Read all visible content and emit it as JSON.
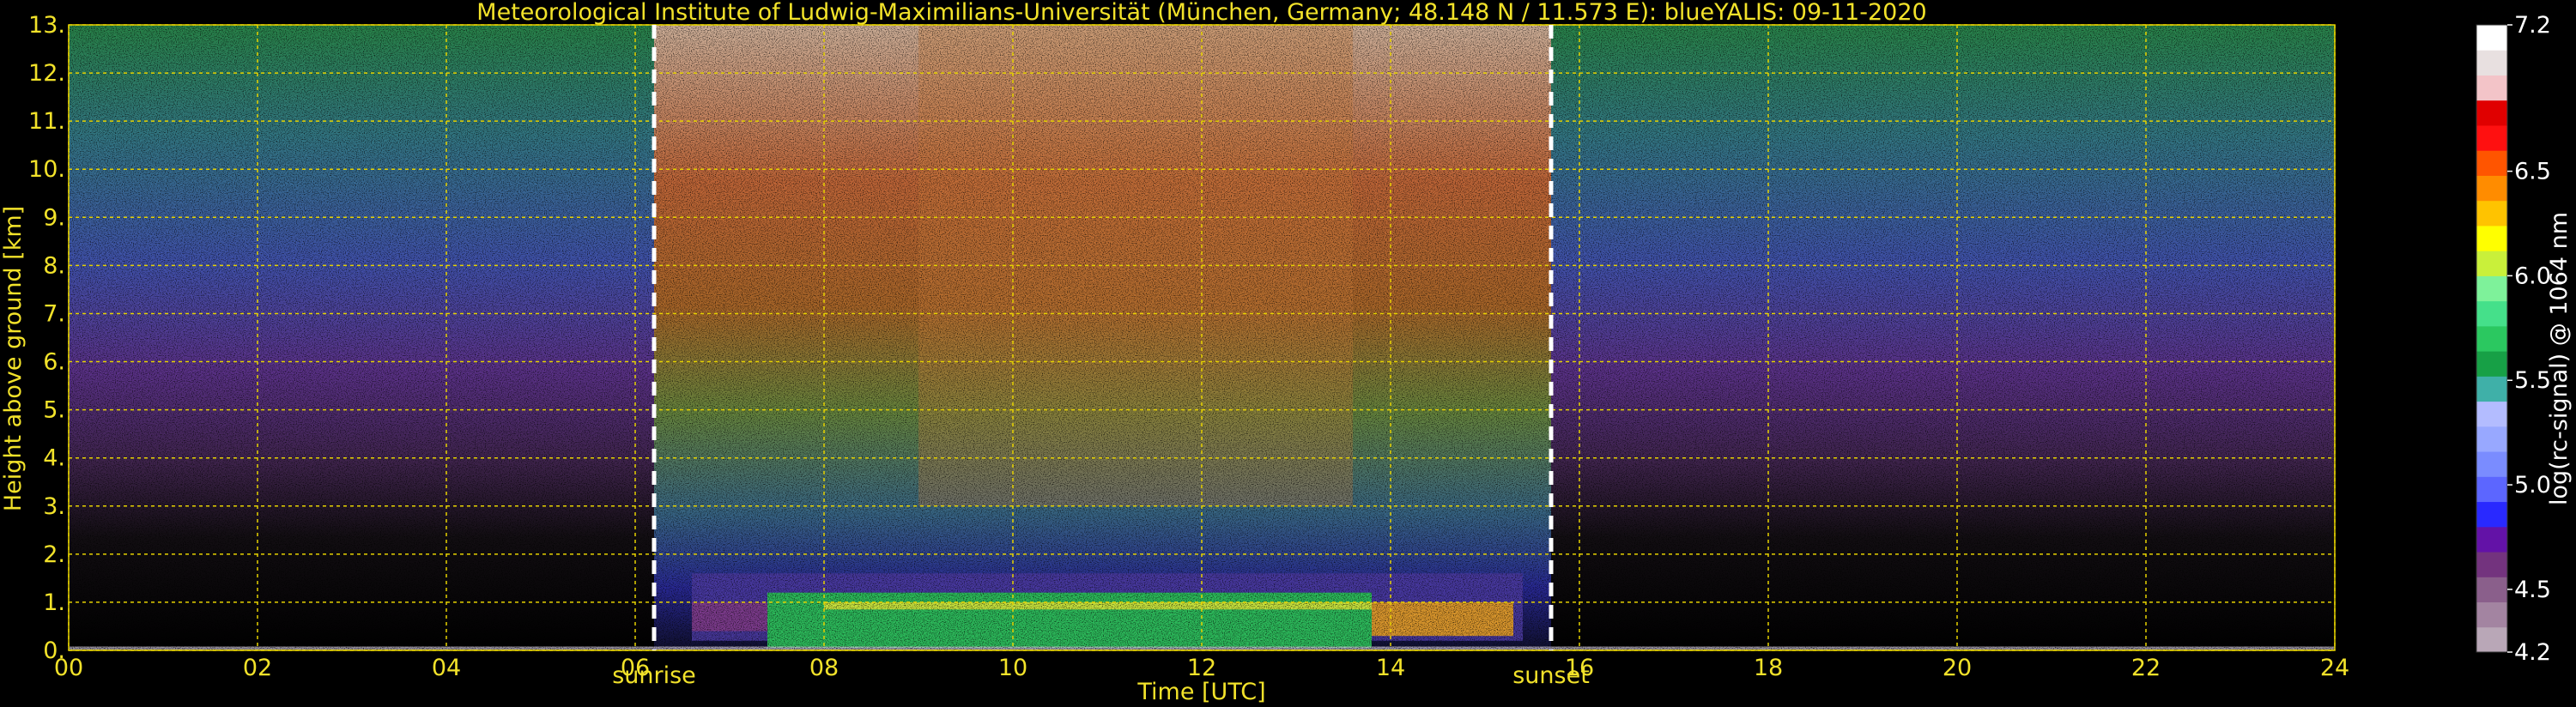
{
  "chart_data": {
    "type": "heatmap",
    "title": "Meteorological Institute of Ludwig-Maximilians-Universität (München, Germany; 48.148 N / 11.573 E):    blueYALIS: 09-11-2020",
    "xlabel": "Time [UTC]",
    "ylabel": "Height above ground [km]",
    "xlim": [
      0,
      24
    ],
    "ylim": [
      0,
      13
    ],
    "x_ticks": [
      "00",
      "02",
      "04",
      "06",
      "08",
      "10",
      "12",
      "14",
      "16",
      "18",
      "20",
      "22",
      "24"
    ],
    "y_ticks": [
      "0.",
      "1.",
      "2.",
      "3.",
      "4.",
      "5.",
      "6.",
      "7.",
      "8.",
      "9.",
      "10.",
      "11.",
      "12.",
      "13."
    ],
    "grid": true,
    "colorbar": {
      "label": "log(rc-signal) @ 1064 nm",
      "range": [
        4.2,
        7.2
      ],
      "tick_labels": [
        "4.2",
        "4.5",
        "5.0",
        "5.5",
        "6.0",
        "6.5",
        "7.2"
      ],
      "tick_values": [
        4.2,
        4.5,
        5.0,
        5.5,
        6.0,
        6.5,
        7.2
      ],
      "colors": [
        "#b9a7b7",
        "#a384a1",
        "#8a5f8b",
        "#73337e",
        "#6312a7",
        "#2929ff",
        "#5c66ff",
        "#7a8cff",
        "#98a8ff",
        "#b3bcff",
        "#3fb0a8",
        "#17a046",
        "#2bc860",
        "#45e08a",
        "#7ef29a",
        "#c9f03a",
        "#ffff00",
        "#ffc300",
        "#ff8c00",
        "#ff5500",
        "#ff1010",
        "#e00000",
        "#f3c4c8",
        "#e8e0e0",
        "#ffffff"
      ]
    },
    "annotations": [
      {
        "text": "sunrise",
        "x": 6.2
      },
      {
        "text": "sunset",
        "x": 15.7
      }
    ]
  }
}
